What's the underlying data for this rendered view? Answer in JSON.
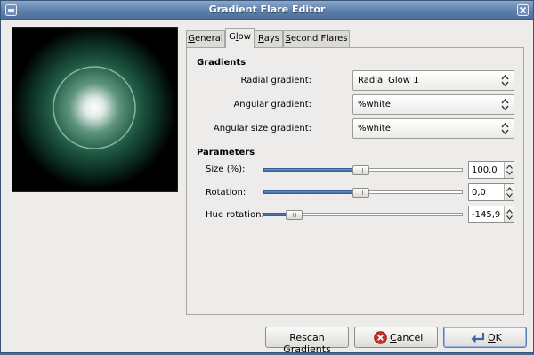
{
  "window": {
    "title": "Gradient Flare Editor"
  },
  "tabs": [
    {
      "label": "General",
      "mnemonic": "G",
      "rest": "eneral",
      "active": false
    },
    {
      "label": "Glow",
      "mnemonic": "l",
      "pre": "G",
      "rest": "ow",
      "active": true
    },
    {
      "label": "Rays",
      "mnemonic": "R",
      "rest": "ays",
      "active": false
    },
    {
      "label": "Second Flares",
      "mnemonic": "S",
      "rest": "econd Flares",
      "active": false
    }
  ],
  "gradients": {
    "title": "Gradients",
    "radial": {
      "label": "Radial gradient:",
      "value": "Radial Glow 1"
    },
    "angular": {
      "label": "Angular gradient:",
      "value": "%white"
    },
    "angular_size": {
      "label": "Angular size gradient:",
      "value": "%white"
    }
  },
  "parameters": {
    "title": "Parameters",
    "size": {
      "label": "Size (%):",
      "value": "100,0",
      "slider_fraction": 0.49
    },
    "rotation": {
      "label": "Rotation:",
      "value": "0,0",
      "slider_fraction": 0.49
    },
    "hue_rotation": {
      "label": "Hue rotation:",
      "value": "-145,9",
      "slider_fraction": 0.12
    }
  },
  "buttons": {
    "rescan": "Rescan Gradients",
    "cancel_mnemonic": "C",
    "cancel_rest": "ancel",
    "ok_mnemonic": "O",
    "ok_rest": "K"
  },
  "colors": {
    "glow_outer": "#1f5a44",
    "glow_core": "#ffffff"
  }
}
